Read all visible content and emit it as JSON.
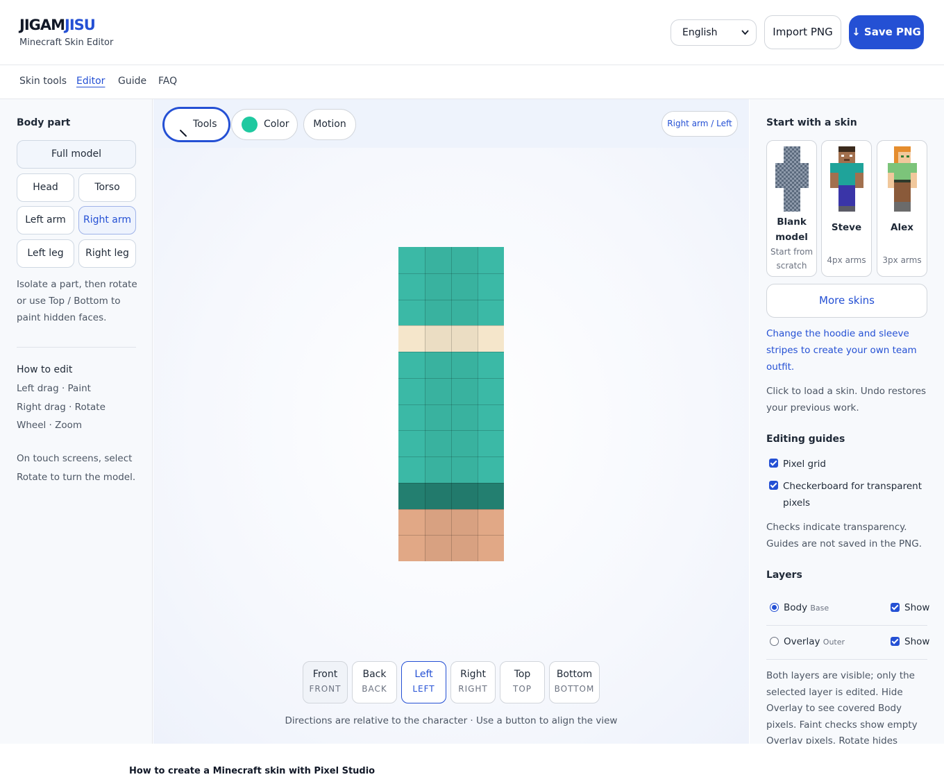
{
  "header": {
    "logo_part1": "JIGAM",
    "logo_part2": "JISU",
    "subtitle": "Minecraft Skin Editor",
    "language": "English",
    "import_label": "Import PNG",
    "save_label": "↓ Save PNG"
  },
  "nav": {
    "items": [
      "Skin tools",
      "Editor",
      "Guide",
      "FAQ"
    ],
    "active": "Editor"
  },
  "left": {
    "heading": "Body part",
    "parts": {
      "full": "Full model",
      "head": "Head",
      "torso": "Torso",
      "left_arm": "Left arm",
      "right_arm": "Right arm",
      "left_leg": "Left leg",
      "right_leg": "Right leg"
    },
    "selected_part": "Right arm",
    "isolate_note": "Isolate a part, then rotate or use Top / Bottom to paint hidden faces.",
    "how_heading": "How to edit",
    "how_lines": [
      "Left drag · Paint",
      "Right drag · Rotate",
      "Wheel · Zoom"
    ],
    "touch_note": "On touch screens, select Rotate to turn the model."
  },
  "toolbar": {
    "tools_label": "Tools",
    "color_label": "Color",
    "motion_label": "Motion",
    "current_color": "#1fc9a0",
    "part_chip": "Right arm / Left"
  },
  "canvas": {
    "row_colors": [
      "#3bb9a6",
      "#3bb9a6",
      "#3bb9a6",
      "#f5e6cb",
      "#3bb9a6",
      "#3bb9a6",
      "#3bb9a6",
      "#3bb9a6",
      "#3bb9a6",
      "#237f70",
      "#e1a886",
      "#e1a886"
    ],
    "column_tint": [
      "#000000",
      "#000000",
      "#000000",
      "#000000"
    ]
  },
  "faces": [
    {
      "label": "Front",
      "sub": "FRONT"
    },
    {
      "label": "Back",
      "sub": "BACK"
    },
    {
      "label": "Left",
      "sub": "LEFT"
    },
    {
      "label": "Right",
      "sub": "RIGHT"
    },
    {
      "label": "Top",
      "sub": "TOP"
    },
    {
      "label": "Bottom",
      "sub": "BOTTOM"
    }
  ],
  "active_face": "Left",
  "center_note": "Directions are relative to the character · Use a button to align the view",
  "right": {
    "start_heading": "Start with a skin",
    "skins": [
      {
        "name": "Blank model",
        "desc": "Start from scratch"
      },
      {
        "name": "Steve",
        "desc": "4px arms"
      },
      {
        "name": "Alex",
        "desc": "3px arms"
      }
    ],
    "more_label": "More skins",
    "hoodie_link": "Change the hoodie and sleeve stripes to create your own team outfit.",
    "load_note": "Click to load a skin. Undo restores your previous work.",
    "guides_heading": "Editing guides",
    "guide_pixel": "Pixel grid",
    "guide_checker": "Checkerboard for transparent pixels",
    "guides_note": "Checks indicate transparency. Guides are not saved in the PNG.",
    "layers_heading": "Layers",
    "layer_body": "Body",
    "layer_body_sub": "Base",
    "layer_overlay": "Overlay",
    "layer_overlay_sub": "Outer",
    "show_label": "Show",
    "layers_note": "Both layers are visible; only the selected layer is edited. Hide Overlay to see covered Body pixels. Faint checks show empty Overlay pixels. Rotate hides editing guides."
  },
  "footer": {
    "heading": "How to create a Minecraft skin with Pixel Studio"
  }
}
